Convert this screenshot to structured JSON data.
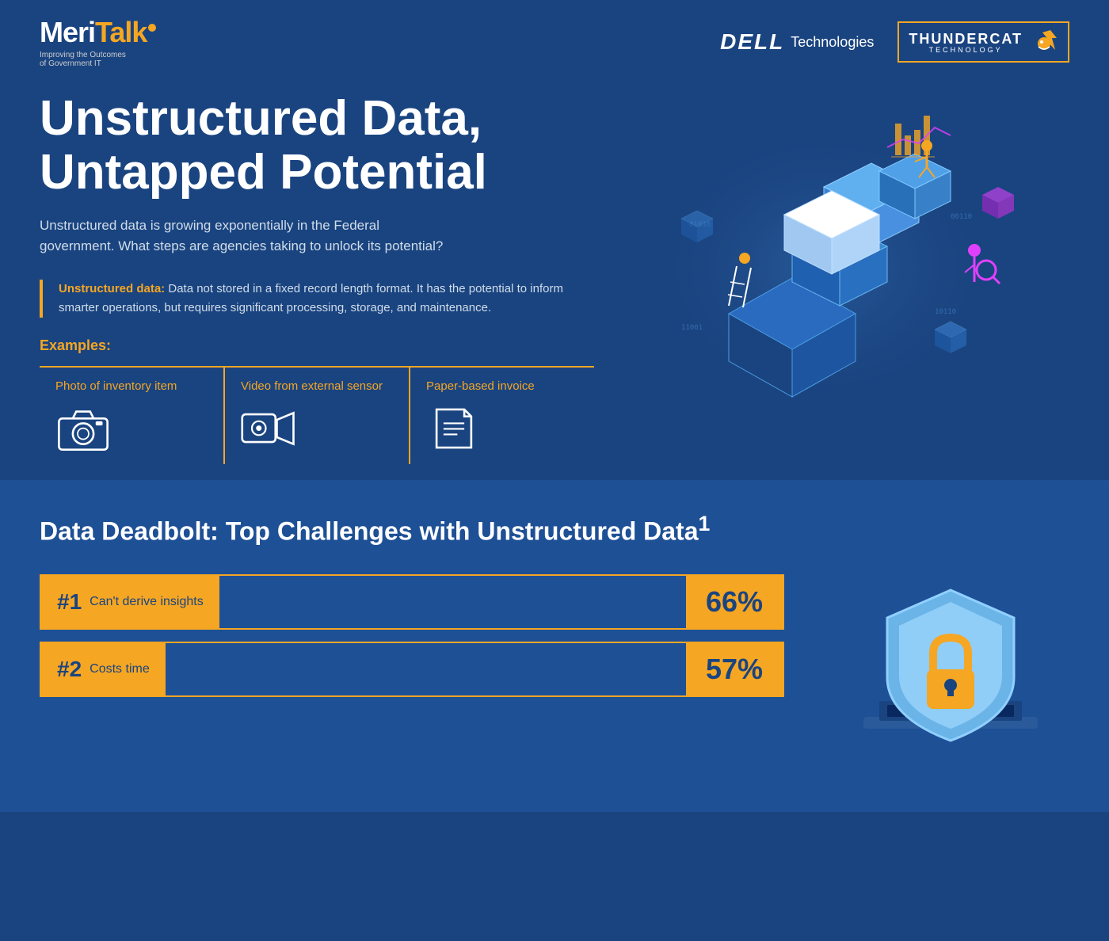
{
  "header": {
    "meritalk": {
      "name": "MeriTalk",
      "tagline": "Improving the Outcomes",
      "tagline2": "of Government IT",
      "trademark": "®"
    },
    "dell": {
      "name": "DELL",
      "suffix": "Technologies"
    },
    "thundercat": {
      "name": "THUNDERCAT",
      "sub": "TECHNOLOGY"
    }
  },
  "hero": {
    "title": "Unstructured Data, Untapped Potential",
    "subtitle": "Unstructured data is growing exponentially in the Federal government.  What steps are agencies taking to unlock its potential?",
    "definition": {
      "term": "Unstructured data:",
      "text": "  Data not stored in a fixed record length format.  It has the potential to inform smarter operations, but requires significant processing, storage, and maintenance."
    },
    "examples_label": "Examples:",
    "examples": [
      {
        "label": "Photo of inventory item",
        "icon": "camera"
      },
      {
        "label": "Video from external sensor",
        "icon": "video"
      },
      {
        "label": "Paper-based invoice",
        "icon": "document"
      }
    ]
  },
  "deadbolt": {
    "title": "Data Deadbolt:  Top Challenges with Unstructured Data",
    "superscript": "1",
    "challenges": [
      {
        "rank": "#1",
        "label": "Can't derive insights",
        "pct": "66%"
      },
      {
        "rank": "#2",
        "label": "Costs time",
        "pct": "57%"
      }
    ]
  }
}
